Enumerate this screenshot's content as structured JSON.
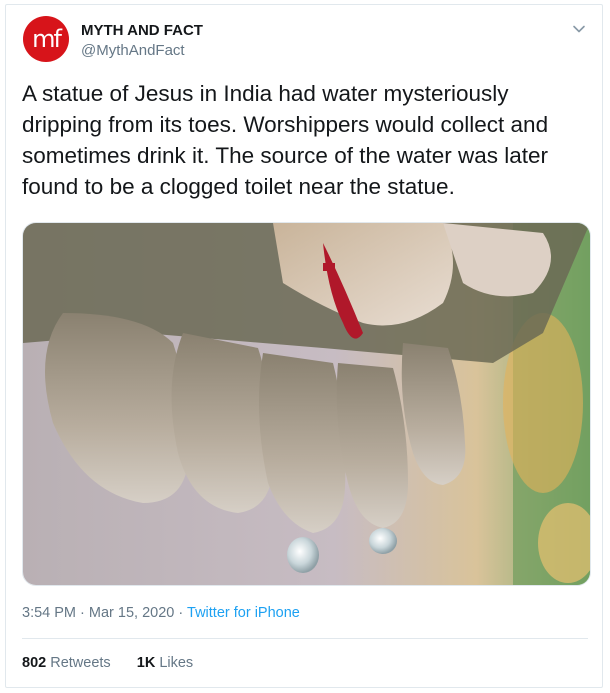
{
  "author": {
    "avatar_text": "mf",
    "name": "MYTH AND FACT",
    "handle": "@MythAndFact"
  },
  "tweet": {
    "text": "A statue of Jesus in India had water mysteriously dripping from its toes. Worshippers would collect and sometimes drink it. The source of the water was later found to be a clogged toilet near the statue."
  },
  "meta": {
    "time": "3:54 PM",
    "separator": "·",
    "date": "Mar 15, 2020",
    "source": "Twitter for iPhone"
  },
  "stats": {
    "retweets_count": "802",
    "retweets_label": "Retweets",
    "likes_count": "1K",
    "likes_label": "Likes"
  },
  "icons": {
    "menu": "chevron-down-icon"
  },
  "colors": {
    "avatar": "#d7141a",
    "link": "#1da1f2",
    "muted": "#657786",
    "text": "#14171a",
    "border": "#e1e8ed"
  }
}
